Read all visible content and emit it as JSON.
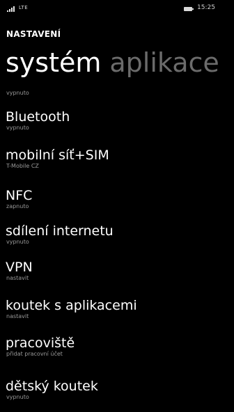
{
  "status_bar": {
    "network": "LTE",
    "time": "15:25"
  },
  "header": {
    "app_title": "NASTAVENÍ",
    "tabs": [
      {
        "label": "systém",
        "active": true
      },
      {
        "label": "aplikace",
        "active": false
      }
    ]
  },
  "list": {
    "top_partial_sub": "vypnuto",
    "items": [
      {
        "label": "Bluetooth",
        "sub": "vypnuto"
      },
      {
        "label": "mobilní síť+SIM",
        "sub": "T-Mobile CZ"
      },
      {
        "label": "NFC",
        "sub": "zapnuto"
      },
      {
        "label": "sdílení internetu",
        "sub": "vypnuto"
      },
      {
        "label": "VPN",
        "sub": "nastavit"
      },
      {
        "label": "koutek s aplikacemi",
        "sub": "nastavit"
      },
      {
        "label": "pracoviště",
        "sub": "přidat pracovní účet"
      },
      {
        "label": "dětský koutek",
        "sub": "vypnuto"
      }
    ]
  },
  "colors": {
    "background": "#000000",
    "text": "#ffffff",
    "subtext": "#9a9a9a",
    "inactive_tab": "#6b6b6b"
  }
}
